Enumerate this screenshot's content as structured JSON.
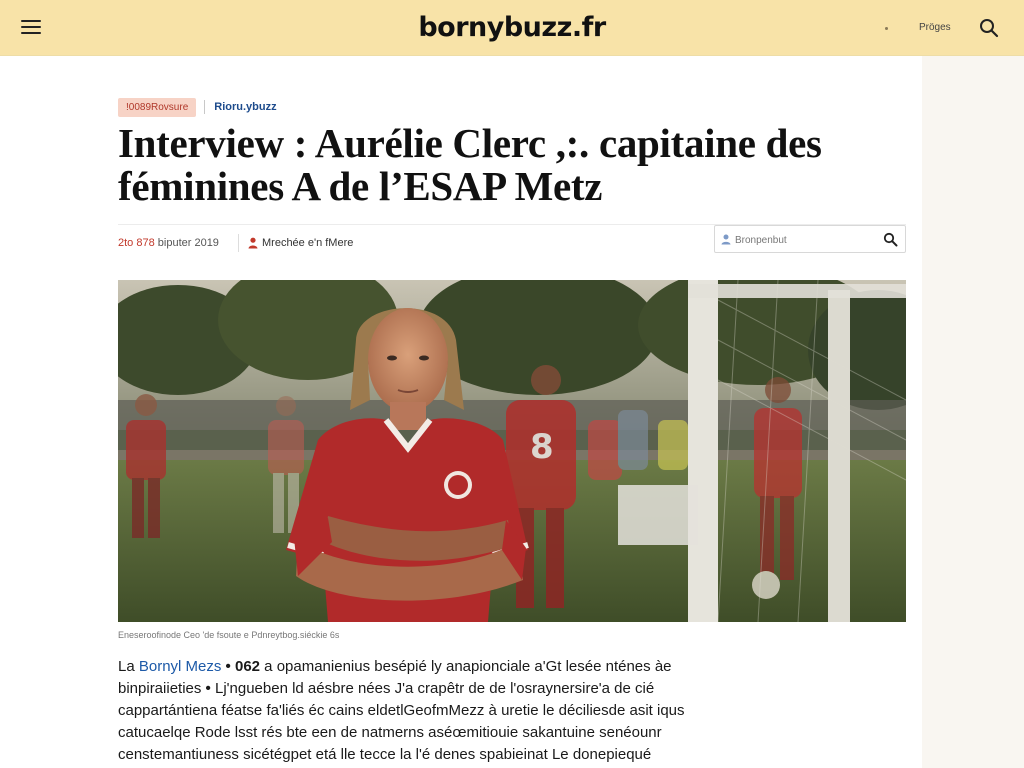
{
  "header": {
    "logo": "bornybuzz.fr",
    "pages_label": "Pröges"
  },
  "article": {
    "category_tag": "!0089Rovsure",
    "site_tag": "Rioru.ybuzz",
    "title_line1": "Interview : Aurélie Clerc ,:. capitaine  des",
    "title_line2": "féminines A de l’ESAP Metz",
    "date": "2to 878",
    "date_suffix": "biputer 2019",
    "author": "Mrechée e'n fMere",
    "search_placeholder": "Bronpenbut",
    "caption": "Eneseroofinode Ceo 'de fsoute e Pdnreytbog.siéckie 6s",
    "body_lines": [
      {
        "start": "La ",
        "link": "Bornyl Mezs",
        "bold": " • 062",
        "rest": " a opamanienius besépié ly anapionciale a'Gt lesée nténes àe"
      },
      {
        "start": "binpiraiieties",
        "bold": " • ",
        "rest": "Lj'ngueben ld aésbre nées  J'a crapêtr de de l'osraynersire'a de cié"
      },
      {
        "start": "cappartántiena féatse fa'liés éc cains eldetlGeofmMezz à uretie le déciliesde asit iqus"
      },
      {
        "start": "catucaelqe Rode lsst rés bte een de natmerns aséœmitiouie sakantuine senéounr"
      },
      {
        "start": "censtemantiuness sicétégpet etá lle tecce la l'é denes spabieinat Le donepiequé"
      }
    ]
  },
  "colors": {
    "header_bg": "#f8e3a8",
    "tag_bg": "#f7d3c6",
    "tag_text": "#b0382a",
    "link_blue": "#1d5aa8",
    "date_red": "#c2392b"
  },
  "icons": {
    "menu": "hamburger-menu-icon",
    "search": "search-icon",
    "author": "person-icon",
    "user": "user-icon"
  }
}
